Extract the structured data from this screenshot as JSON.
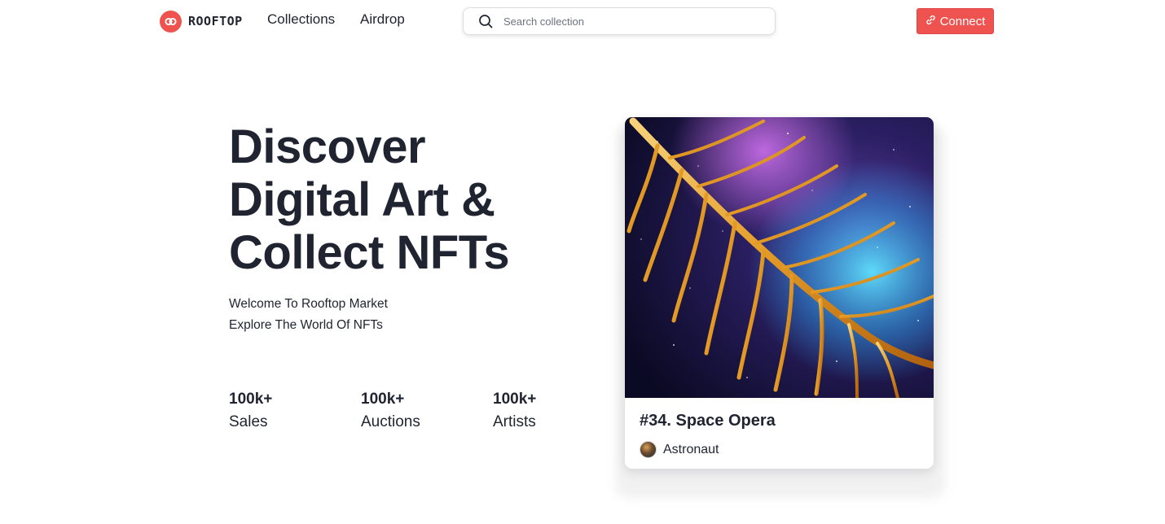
{
  "header": {
    "logo_text": "ROOFTOP",
    "nav": [
      {
        "label": "Collections"
      },
      {
        "label": "Airdrop"
      }
    ],
    "search": {
      "placeholder": "Search collection",
      "value": ""
    },
    "connect_label": "Connect"
  },
  "hero": {
    "title_lines": [
      "Discover",
      "Digital Art &",
      "Collect NFTs"
    ],
    "subtitle_lines": [
      "Welcome To Rooftop Market",
      "Explore The World Of NFTs"
    ],
    "stats": [
      {
        "value": "100k+",
        "label": "Sales"
      },
      {
        "value": "100k+",
        "label": "Auctions"
      },
      {
        "value": "100k+",
        "label": "Artists"
      }
    ]
  },
  "featured_nft": {
    "title": "#34. Space Opera",
    "creator": "Astronaut"
  },
  "colors": {
    "accent": "#ef5350",
    "text": "#1f2430"
  },
  "icons": {
    "logo": "link-circle-icon",
    "search": "search-icon",
    "connect": "link-icon"
  }
}
